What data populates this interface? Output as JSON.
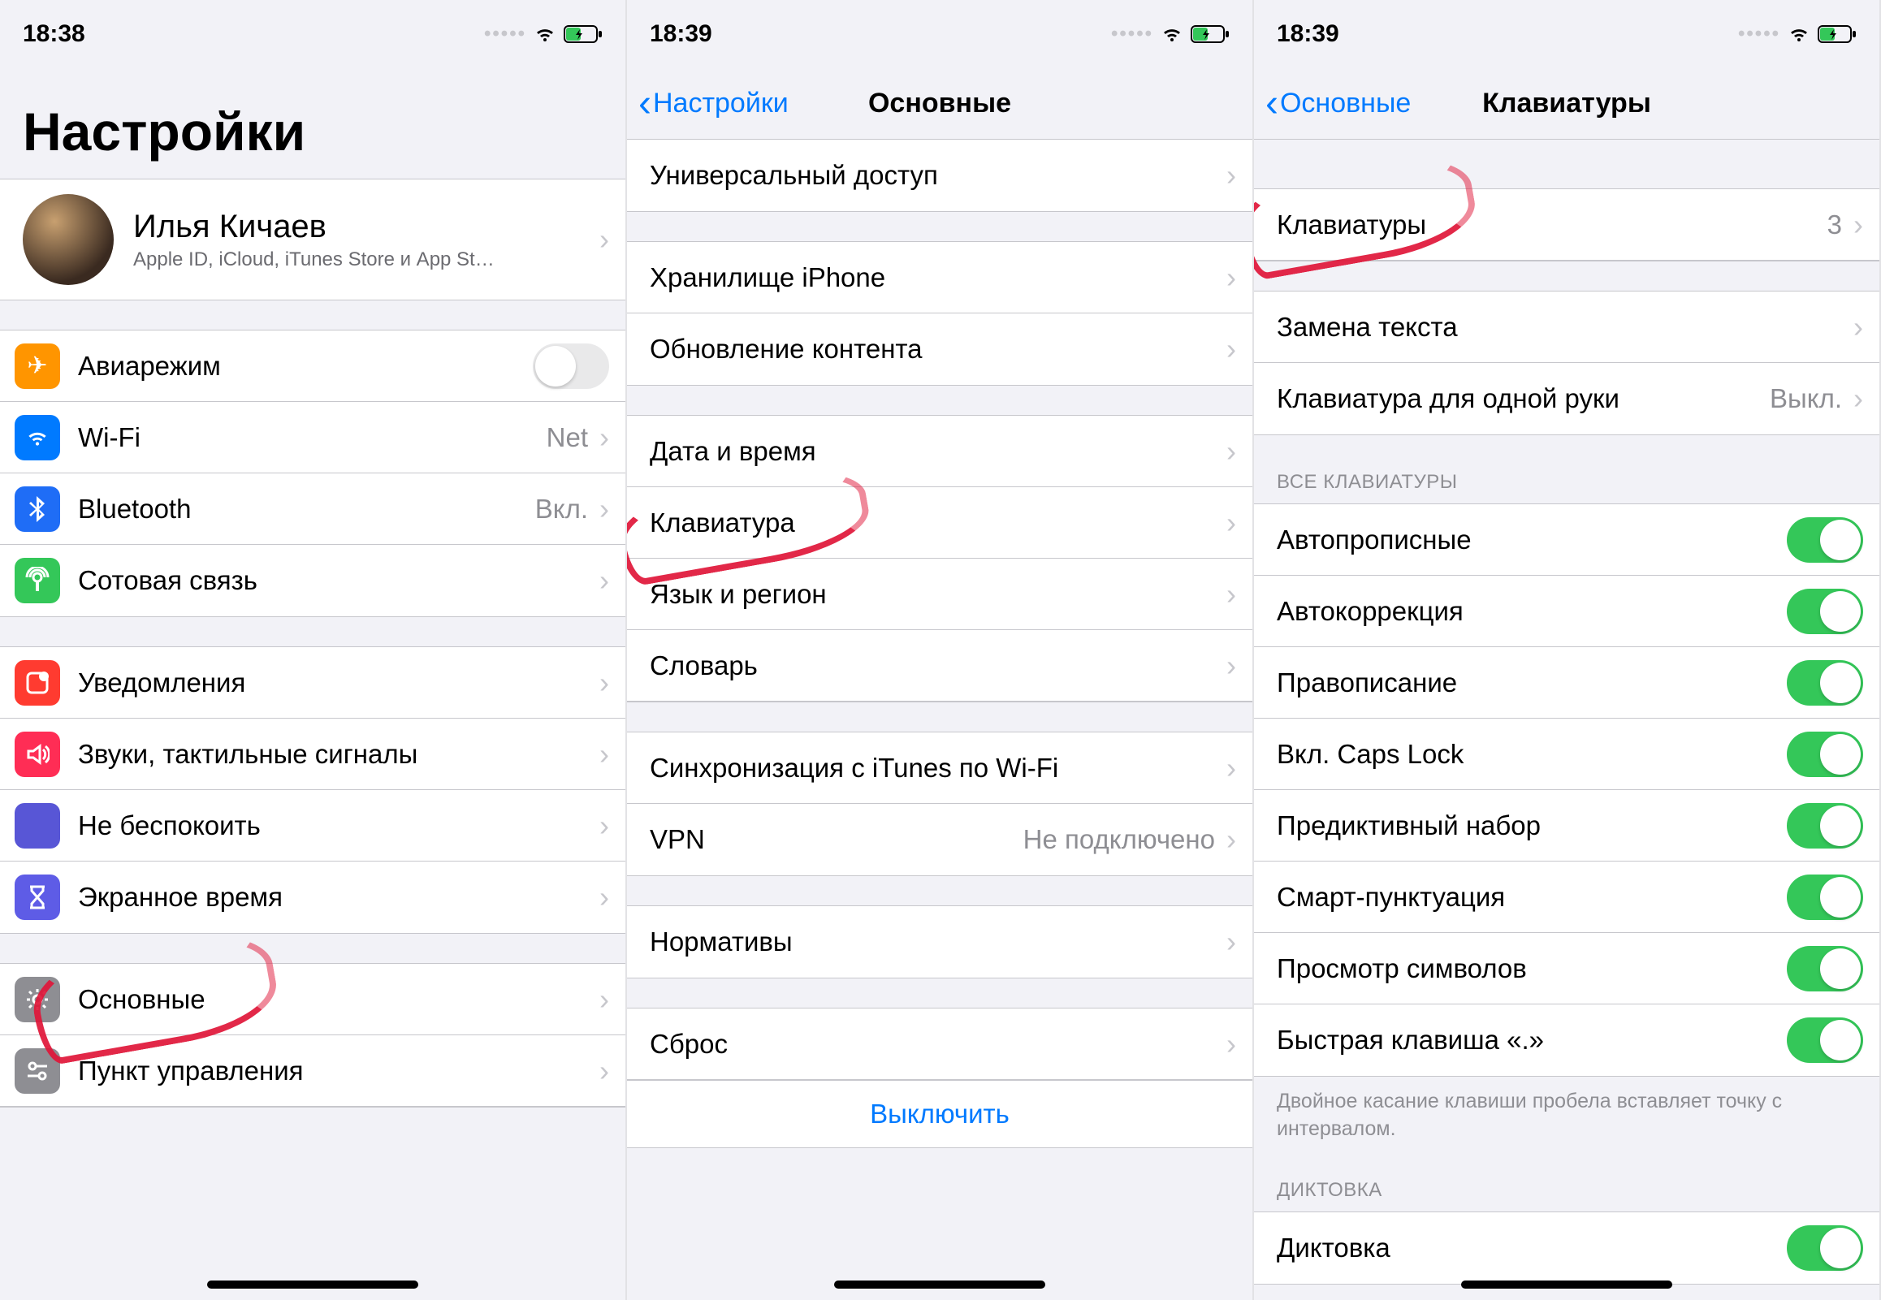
{
  "screen1": {
    "status": {
      "time": "18:38"
    },
    "title": "Настройки",
    "profile": {
      "name": "Илья Кичаев",
      "subtitle": "Apple ID, iCloud, iTunes Store и App St…"
    },
    "g1": {
      "airplane": "Авиарежим",
      "wifi": "Wi-Fi",
      "wifi_val": "Net",
      "bt": "Bluetooth",
      "bt_val": "Вкл.",
      "cell": "Сотовая связь"
    },
    "g2": {
      "notif": "Уведомления",
      "sounds": "Звуки, тактильные сигналы",
      "dnd": "Не беспокоить",
      "screentime": "Экранное время"
    },
    "g3": {
      "general": "Основные",
      "control": "Пункт управления"
    }
  },
  "screen2": {
    "status": {
      "time": "18:39"
    },
    "back": "Настройки",
    "title": "Основные",
    "g1": {
      "access": "Универсальный доступ"
    },
    "g2": {
      "storage": "Хранилище iPhone",
      "refresh": "Обновление контента"
    },
    "g3": {
      "date": "Дата и время",
      "keyboard": "Клавиатура",
      "lang": "Язык и регион",
      "dict": "Словарь"
    },
    "g4": {
      "itunes": "Синхронизация с iTunes по Wi-Fi",
      "vpn": "VPN",
      "vpn_val": "Не подключено"
    },
    "g5": {
      "reg": "Нормативы"
    },
    "g6": {
      "reset": "Сброс",
      "shutdown": "Выключить"
    }
  },
  "screen3": {
    "status": {
      "time": "18:39"
    },
    "back": "Основные",
    "title": "Клавиатуры",
    "g1": {
      "keyboards": "Клавиатуры",
      "keyboards_count": "3"
    },
    "g2": {
      "textrepl": "Замена текста",
      "onehand": "Клавиатура для одной руки",
      "onehand_val": "Выкл."
    },
    "header_all": "ВСЕ КЛАВИАТУРЫ",
    "g3": {
      "autocap": "Автопрописные",
      "autocorrect": "Автокоррекция",
      "spell": "Правописание",
      "caps": "Вкл. Caps Lock",
      "predict": "Предиктивный набор",
      "smart": "Смарт-пунктуация",
      "preview": "Просмотр символов",
      "shortcut": "Быстрая клавиша «.»"
    },
    "foot": "Двойное касание клавиши пробела вставляет точку с интервалом.",
    "header_dict": "ДИКТОВКА",
    "g4": {
      "dict": "Диктовка"
    }
  }
}
